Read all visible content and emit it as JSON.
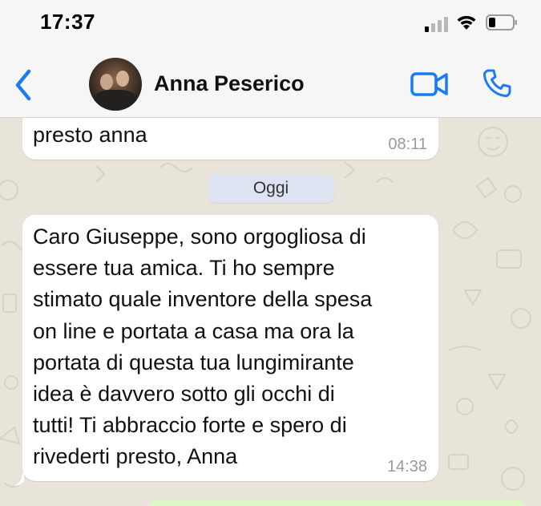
{
  "status_bar": {
    "time": "17:37"
  },
  "header": {
    "contact_name": "Anna Peserico"
  },
  "messages": [
    {
      "text": "presto anna",
      "time": "08:11"
    },
    {
      "text": "Caro Giuseppe, sono orgogliosa di\nessere tua amica. Ti ho sempre\nstimato quale inventore della spesa\non line e portata a casa ma ora la\nportata di questa tua lungimirante\nidea è davvero sotto gli occhi di\ntutti! Ti abbraccio forte e spero di\nrivederti presto, Anna",
      "time": "14:38"
    }
  ],
  "date_separator": "Oggi",
  "icons": {
    "back": "chevron-left-icon",
    "video": "video-camera-icon",
    "phone": "phone-icon",
    "signal": "cellular-signal-icon",
    "wifi": "wifi-icon",
    "battery": "battery-icon"
  },
  "colors": {
    "accent": "#1a7cf0",
    "bubble": "#ffffff",
    "date_chip": "#dde3f0",
    "chat_background": "#e9e4da"
  }
}
